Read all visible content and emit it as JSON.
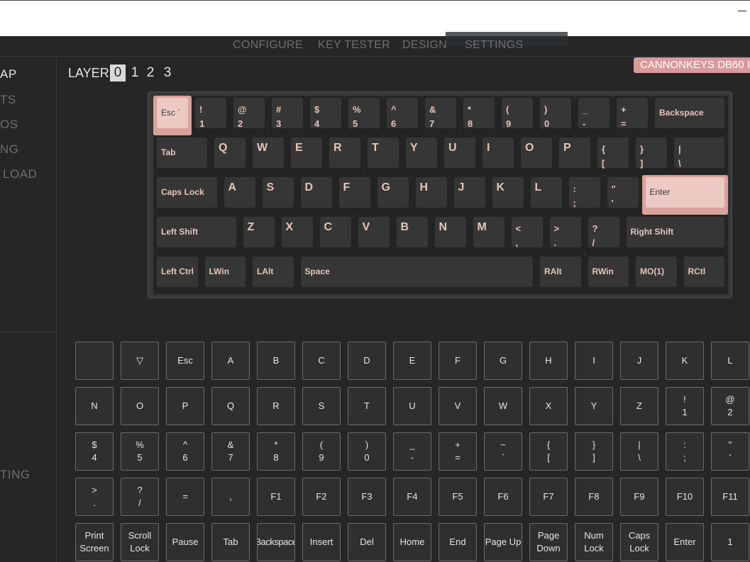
{
  "nav": {
    "tabs": [
      {
        "label": "CONFIGURE",
        "active": true
      },
      {
        "label": "KEY TESTER"
      },
      {
        "label": "DESIGN"
      },
      {
        "label": "SETTINGS"
      }
    ]
  },
  "sidebar": {
    "top_items": [
      {
        "label": "AP",
        "active": true
      },
      {
        "label": "TS"
      },
      {
        "label": "OS"
      },
      {
        "label": "NG"
      },
      {
        "label": "LOAD"
      }
    ],
    "bottom_items": [
      {
        "label": "TING"
      }
    ]
  },
  "layers": {
    "label": "LAYER",
    "options": [
      "0",
      "1",
      "2",
      "3"
    ],
    "active": "0"
  },
  "keyboard_name": "CANNONKEYS DB60 I",
  "keyboard": {
    "rows": [
      [
        {
          "l": "Esc `",
          "w": 1,
          "sel": true,
          "s": "sm"
        },
        {
          "l": "!\n1"
        },
        {
          "l": "@\n2"
        },
        {
          "l": "#\n3"
        },
        {
          "l": "$\n4"
        },
        {
          "l": "%\n5"
        },
        {
          "l": "^\n6"
        },
        {
          "l": "&\n7"
        },
        {
          "l": "*\n8"
        },
        {
          "l": "(\n9"
        },
        {
          "l": ")\n0"
        },
        {
          "l": "_\n-"
        },
        {
          "l": "+\n="
        },
        {
          "l": "Backspace",
          "w": 2,
          "s": "sm"
        }
      ],
      [
        {
          "l": "Tab",
          "w": 1.5,
          "s": "sm"
        },
        {
          "l": "Q",
          "s": "big"
        },
        {
          "l": "W",
          "s": "big"
        },
        {
          "l": "E",
          "s": "big"
        },
        {
          "l": "R",
          "s": "big"
        },
        {
          "l": "T",
          "s": "big"
        },
        {
          "l": "Y",
          "s": "big"
        },
        {
          "l": "U",
          "s": "big"
        },
        {
          "l": "I",
          "s": "big"
        },
        {
          "l": "O",
          "s": "big"
        },
        {
          "l": "P",
          "s": "big"
        },
        {
          "l": "{\n["
        },
        {
          "l": "}\n]"
        },
        {
          "l": "|\n\\",
          "w": 1.5
        }
      ],
      [
        {
          "l": "Caps Lock",
          "w": 1.75,
          "s": "sm"
        },
        {
          "l": "A",
          "s": "big"
        },
        {
          "l": "S",
          "s": "big"
        },
        {
          "l": "D",
          "s": "big"
        },
        {
          "l": "F",
          "s": "big"
        },
        {
          "l": "G",
          "s": "big"
        },
        {
          "l": "H",
          "s": "big"
        },
        {
          "l": "J",
          "s": "big"
        },
        {
          "l": "K",
          "s": "big"
        },
        {
          "l": "L",
          "s": "big"
        },
        {
          "l": ":\n;"
        },
        {
          "l": "\"\n'"
        },
        {
          "l": "Enter",
          "w": 2.25,
          "sel": true,
          "s": "sm"
        }
      ],
      [
        {
          "l": "Left Shift",
          "w": 2.25,
          "s": "sm"
        },
        {
          "l": "Z",
          "s": "big"
        },
        {
          "l": "X",
          "s": "big"
        },
        {
          "l": "C",
          "s": "big"
        },
        {
          "l": "V",
          "s": "big"
        },
        {
          "l": "B",
          "s": "big"
        },
        {
          "l": "N",
          "s": "big"
        },
        {
          "l": "M",
          "s": "big"
        },
        {
          "l": "<\n,"
        },
        {
          "l": ">\n."
        },
        {
          "l": "?\n/"
        },
        {
          "l": "Right Shift",
          "w": 2.75,
          "s": "sm"
        }
      ],
      [
        {
          "l": "Left Ctrl",
          "w": 1.25,
          "s": "sm"
        },
        {
          "l": "LWin",
          "w": 1.25,
          "s": "sm"
        },
        {
          "l": "LAlt",
          "w": 1.25,
          "s": "sm"
        },
        {
          "l": "Space",
          "w": 6.25,
          "s": "sm"
        },
        {
          "l": "RAlt",
          "w": 1.25,
          "s": "sm"
        },
        {
          "l": "RWin",
          "w": 1.25,
          "s": "sm"
        },
        {
          "l": "MO(1)",
          "w": 1.25,
          "s": "sm"
        },
        {
          "l": "RCtl",
          "w": 1.25,
          "s": "sm"
        }
      ]
    ]
  },
  "palette": {
    "rows": [
      [
        "",
        "▽",
        "Esc",
        "A",
        "B",
        "C",
        "D",
        "E",
        "F",
        "G",
        "H",
        "I",
        "J",
        "K",
        "L"
      ],
      [
        "N",
        "O",
        "P",
        "Q",
        "R",
        "S",
        "T",
        "U",
        "V",
        "W",
        "X",
        "Y",
        "Z",
        "!\n1",
        "@\n2"
      ],
      [
        "$\n4",
        "%\n5",
        "^\n6",
        "&\n7",
        "*\n8",
        "(\n9",
        ")\n0",
        "_\n-",
        "+\n=",
        "~\n`",
        "{\n[",
        "}\n]",
        "|\n\\",
        ":\n;",
        "\"\n'"
      ],
      [
        ">\n.",
        "?\n/",
        "=",
        ",",
        "F1",
        "F2",
        "F3",
        "F4",
        "F5",
        "F6",
        "F7",
        "F8",
        "F9",
        "F10",
        "F11"
      ],
      [
        "Print\nScreen",
        "Scroll\nLock",
        "Pause",
        "Tab",
        "Backspace",
        "Insert",
        "Del",
        "Home",
        "End",
        "Page Up",
        "Page\nDown",
        "Num\nLock",
        "Caps\nLock",
        "Enter",
        "1"
      ]
    ]
  },
  "colors": {
    "accent": "#d89a9a",
    "legend": "#e8c4bd",
    "selected_key": "#ecc9c2"
  }
}
